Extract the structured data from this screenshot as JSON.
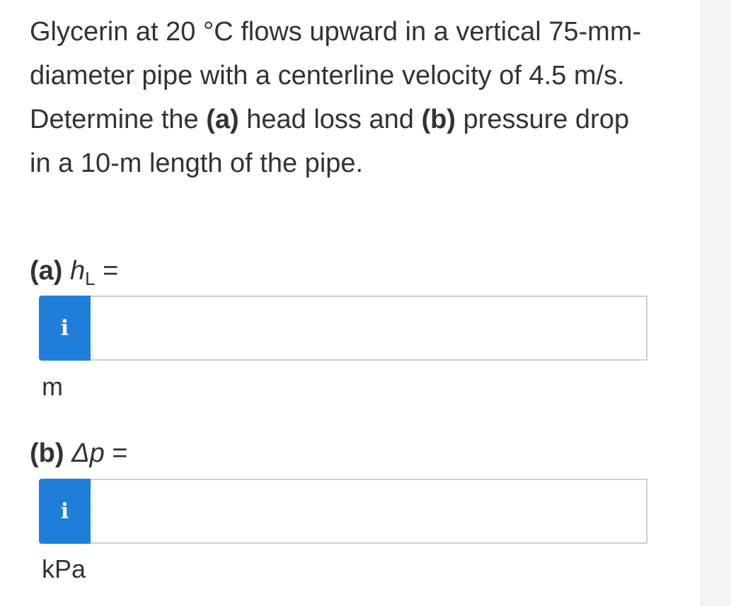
{
  "problem": {
    "text_1": "Glycerin at 20 °C flows upward in a vertical 75-mm-diameter pipe with a centerline velocity of 4.5 m/s. Determine the ",
    "part_a_marker": "(a)",
    "text_2": " head loss and ",
    "part_b_marker": "(b)",
    "text_3": " pressure drop in a 10-m length of the pipe."
  },
  "part_a": {
    "label_marker": "(a)",
    "variable": "h",
    "subscript": "L",
    "equals": " =",
    "info_icon": "i",
    "input_value": "",
    "unit": "m"
  },
  "part_b": {
    "label_marker": "(b)",
    "variable": "Δp",
    "equals": " =",
    "info_icon": "i",
    "input_value": "",
    "unit": "kPa"
  },
  "colors": {
    "info_button": "#1f7fd8",
    "text": "#333333",
    "input_border": "#cfcfcf",
    "gutter": "#f4f4f4"
  }
}
